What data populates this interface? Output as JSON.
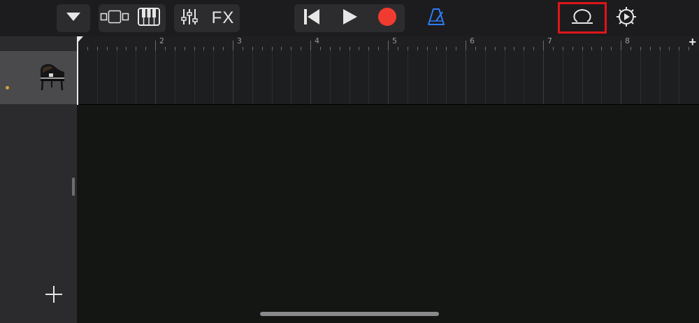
{
  "toolbar": {
    "browser_button": {
      "icon": "triangle-down-icon"
    },
    "view_buttons": [
      {
        "icon": "tracks-view-icon"
      },
      {
        "icon": "keyboard-icon"
      }
    ],
    "mix_buttons": [
      {
        "icon": "mixer-icon"
      },
      {
        "label": "FX"
      }
    ],
    "transport": [
      {
        "icon": "go-to-beginning-icon"
      },
      {
        "icon": "play-icon"
      },
      {
        "icon": "record-icon",
        "color": "#f23b30"
      }
    ],
    "metronome": {
      "icon": "metronome-icon",
      "color": "#2f7bf5"
    },
    "loop_browser": {
      "icon": "loop-icon",
      "highlighted": true,
      "highlight_color": "#e0141a"
    },
    "settings": {
      "icon": "settings-gear-icon"
    }
  },
  "ruler": {
    "bar_numbers": [
      "2",
      "3",
      "4",
      "5",
      "6",
      "7",
      "8"
    ],
    "add_section_label": "+"
  },
  "tracks": [
    {
      "instrument_icon": "grand-piano-icon",
      "indicator_color": "#d9a13a"
    }
  ],
  "sidebar": {
    "add_track_icon": "plus-icon"
  }
}
